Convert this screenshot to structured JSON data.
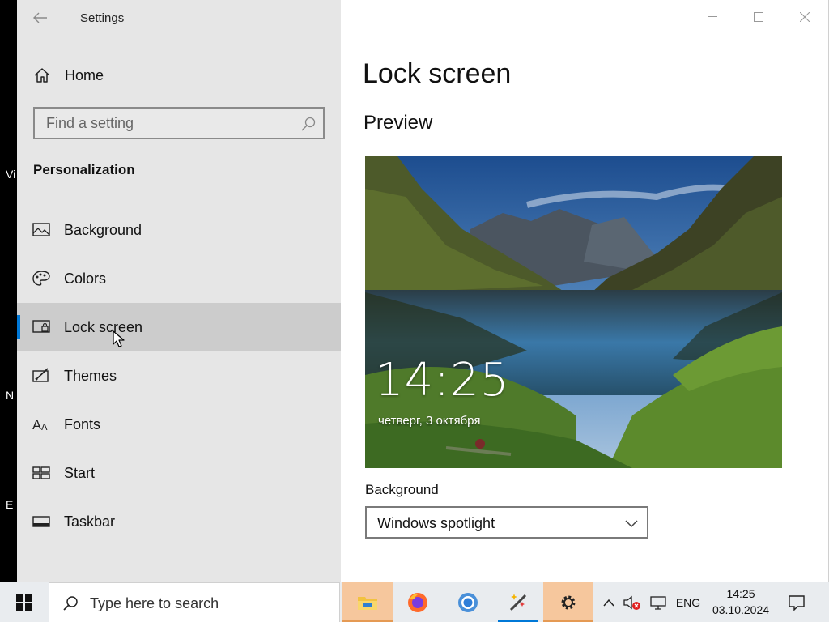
{
  "desktop": {
    "fragments": [
      "Vi",
      "N",
      "E"
    ]
  },
  "window": {
    "title": "Settings",
    "controls": [
      "minimize",
      "maximize",
      "close"
    ]
  },
  "sidebar": {
    "home_label": "Home",
    "search_placeholder": "Find a setting",
    "section_title": "Personalization",
    "items": [
      {
        "label": "Background",
        "icon": "picture-icon",
        "selected": false
      },
      {
        "label": "Colors",
        "icon": "palette-icon",
        "selected": false
      },
      {
        "label": "Lock screen",
        "icon": "lock-screen-icon",
        "selected": true
      },
      {
        "label": "Themes",
        "icon": "themes-icon",
        "selected": false
      },
      {
        "label": "Fonts",
        "icon": "fonts-icon",
        "selected": false
      },
      {
        "label": "Start",
        "icon": "start-icon",
        "selected": false
      },
      {
        "label": "Taskbar",
        "icon": "taskbar-icon",
        "selected": false
      }
    ]
  },
  "main": {
    "page_title": "Lock screen",
    "preview_title": "Preview",
    "preview_time": "14:25",
    "preview_date": "четверг, 3 октября",
    "background_label": "Background",
    "background_value": "Windows spotlight"
  },
  "taskbar": {
    "search_placeholder": "Type here to search",
    "apps": [
      "file-explorer-icon",
      "firefox-icon",
      "chrome-icon",
      "magic-wand-icon",
      "settings-gear-icon"
    ],
    "language": "ENG",
    "time": "14:25",
    "date": "03.10.2024"
  },
  "colors": {
    "accent": "#0078d7",
    "sidebar_bg": "#e6e6e6",
    "selected_bg": "#cccccc",
    "taskbar_active": "#f6c79d"
  }
}
